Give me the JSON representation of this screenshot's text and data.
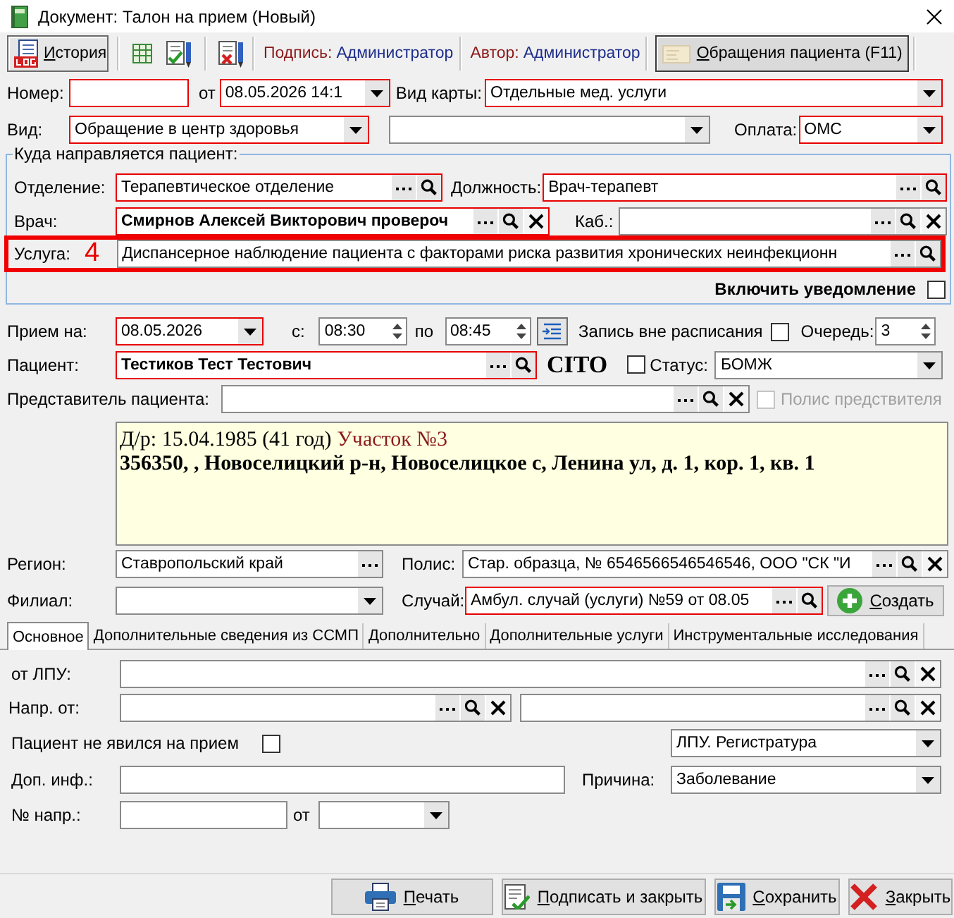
{
  "window": {
    "title": "Документ: Талон на прием (Новый)"
  },
  "toolbar": {
    "history_button": {
      "label": "История",
      "access_key_underlined": true
    },
    "signature": {
      "label": "Подпись:",
      "value": "Администратор"
    },
    "author": {
      "label": "Автор:",
      "value": "Администратор"
    },
    "patient_visits_button": {
      "label": "Обращения пациента (F11)",
      "pressed": true,
      "access_key_underlined": true
    }
  },
  "header": {
    "rows": [
      {
        "items": [
          {
            "kind": "label",
            "text": "Номер:"
          },
          {
            "kind": "text",
            "required": true
          },
          {
            "kind": "label",
            "text": "от"
          },
          {
            "kind": "combo",
            "value": "08.05.2026 14:1",
            "required": true
          },
          {
            "kind": "label",
            "text": "Вид карты:"
          },
          {
            "kind": "combo",
            "value": "Отдельные мед. услуги",
            "required": true
          }
        ]
      },
      {
        "items": [
          {
            "kind": "label",
            "text": "Вид:"
          },
          {
            "kind": "combo",
            "value": "Обращение в центр здоровья",
            "required": true
          },
          {
            "kind": "combo",
            "required": false
          },
          {
            "kind": "label",
            "text": "Оплата:"
          },
          {
            "kind": "combo",
            "value": "ОМС",
            "required": true
          }
        ]
      }
    ]
  },
  "referral": {
    "title": "Куда направляется пациент:",
    "rows": [
      {
        "highlighted": false,
        "items": [
          {
            "kind": "label",
            "text": "Отделение:"
          },
          {
            "kind": "lookup",
            "value": "Терапевтическое отделение",
            "required": true,
            "searchable": true,
            "clearable": false
          },
          {
            "kind": "label",
            "text": "Должность:"
          },
          {
            "kind": "lookup",
            "value": "Врач-терапевт",
            "required": true,
            "searchable": true,
            "clearable": false
          }
        ]
      },
      {
        "highlighted": false,
        "items": [
          {
            "kind": "label",
            "text": "Врач:"
          },
          {
            "kind": "lookup",
            "value": "Смирнов Алексей Викторович провероч",
            "required": true,
            "searchable": true,
            "clearable": true
          },
          {
            "kind": "label",
            "text": "Каб.:"
          },
          {
            "kind": "lookup",
            "required": false,
            "searchable": true,
            "clearable": true
          }
        ]
      },
      {
        "highlighted": true,
        "items": [
          {
            "kind": "label",
            "text": "Услуга:"
          },
          {
            "kind": "marker",
            "text": "4"
          },
          {
            "kind": "lookup",
            "value": "Диспансерное наблюдение пациента с факторами риска развития хронических неинфекционн",
            "required": false,
            "searchable": true,
            "clearable": false
          }
        ]
      },
      {
        "highlighted": false,
        "items": [
          {
            "kind": "label",
            "text": "Включить уведомление"
          },
          {
            "kind": "checkbox",
            "checked": false,
            "disabled": false
          }
        ]
      }
    ]
  },
  "appointment": {
    "rows": [
      {
        "items": [
          {
            "kind": "label",
            "text": "Прием на:"
          },
          {
            "kind": "combo",
            "value": "08.05.2026",
            "required": true
          },
          {
            "kind": "label",
            "text": "с:"
          },
          {
            "kind": "spin",
            "value": "08:30",
            "required": false
          },
          {
            "kind": "label",
            "text": "по"
          },
          {
            "kind": "spin",
            "value": "08:45",
            "required": false
          },
          {
            "kind": "tool"
          },
          {
            "kind": "label",
            "text": "Запись вне расписания"
          },
          {
            "kind": "checkbox",
            "checked": false,
            "disabled": false
          },
          {
            "kind": "label",
            "text": "Очередь:"
          },
          {
            "kind": "spin",
            "value": "3",
            "required": false
          }
        ]
      },
      {
        "items": [
          {
            "kind": "label",
            "text": "Пациент:"
          },
          {
            "kind": "lookup",
            "value": "Тестиков Тест Тестович",
            "required": true,
            "searchable": true,
            "clearable": false
          },
          {
            "kind": "tag",
            "text": "CITO"
          },
          {
            "kind": "checkbox",
            "checked": false,
            "disabled": false
          },
          {
            "kind": "label",
            "text": "Статус:"
          },
          {
            "kind": "combo",
            "value": "БОМЖ",
            "required": false
          }
        ]
      },
      {
        "items": [
          {
            "kind": "label",
            "text": "Представитель пациента:"
          },
          {
            "kind": "lookup",
            "required": false,
            "searchable": true,
            "clearable": true
          },
          {
            "kind": "checkbox",
            "label": "Полис предствителя",
            "checked": false,
            "disabled": true
          }
        ]
      },
      {
        "items": [
          {
            "kind": "info",
            "birth": "Д/р: 15.04.1985 (41 год)",
            "district": "Участок №3",
            "address": "356350, , Новоселицкий р-н, Новоселицкое с, Ленина ул, д. 1, кор. 1, кв. 1"
          }
        ]
      },
      {
        "items": [
          {
            "kind": "label",
            "text": "Регион:"
          },
          {
            "kind": "lookup",
            "value": "Ставропольский край",
            "required": false,
            "searchable": false,
            "clearable": false
          },
          {
            "kind": "label",
            "text": "Полис:"
          },
          {
            "kind": "lookup",
            "value": "Стар. образца, № 6546566546546546, ООО \"СК \"И",
            "required": false,
            "searchable": true,
            "clearable": true
          }
        ]
      },
      {
        "items": [
          {
            "kind": "label",
            "text": "Филиал:"
          },
          {
            "kind": "combo",
            "required": false
          },
          {
            "kind": "label",
            "text": "Случай:"
          },
          {
            "kind": "lookup",
            "value": "Амбул. случай (услуги) №59 от 08.05",
            "required": true,
            "searchable": true,
            "clearable": false
          },
          {
            "kind": "button",
            "label": "Создать",
            "access_key_underlined": true
          }
        ]
      }
    ]
  },
  "tabs": [
    {
      "label": "Основное",
      "selected": true
    },
    {
      "label": "Дополнительные сведения из ССМП",
      "selected": false
    },
    {
      "label": "Дополнительно",
      "selected": false
    },
    {
      "label": "Дополнительные услуги",
      "selected": false
    },
    {
      "label": "Инструментальные исследования",
      "selected": false
    }
  ],
  "tab_content": {
    "rows": [
      {
        "items": [
          {
            "kind": "label",
            "text": "от ЛПУ:"
          },
          {
            "kind": "lookup",
            "required": false,
            "searchable": true,
            "clearable": true
          }
        ]
      },
      {
        "items": [
          {
            "kind": "label",
            "text": "Напр. от:"
          },
          {
            "kind": "lookup",
            "required": false,
            "searchable": true,
            "clearable": true
          },
          {
            "kind": "lookup",
            "required": false,
            "searchable": true,
            "clearable": true
          }
        ]
      },
      {
        "items": [
          {
            "kind": "label",
            "text": "Пациент не явился на прием"
          },
          {
            "kind": "checkbox",
            "checked": false,
            "disabled": false
          },
          {
            "kind": "combo",
            "value": "ЛПУ. Регистратура",
            "required": false
          }
        ]
      },
      {
        "items": [
          {
            "kind": "label",
            "text": "Доп. инф.:"
          },
          {
            "kind": "text",
            "required": false
          },
          {
            "kind": "label",
            "text": "Причина:"
          },
          {
            "kind": "combo",
            "value": "Заболевание",
            "required": false
          }
        ]
      },
      {
        "items": [
          {
            "kind": "label",
            "text": "№ напр.:"
          },
          {
            "kind": "text",
            "required": false
          },
          {
            "kind": "label",
            "text": "от"
          },
          {
            "kind": "combo",
            "required": false
          }
        ]
      }
    ]
  },
  "footer_buttons": [
    {
      "kind": "print",
      "label": "Печать",
      "access_key_underlined": true
    },
    {
      "kind": "sign",
      "label": "Подписать и закрыть",
      "access_key_underlined": true
    },
    {
      "kind": "save",
      "label": "Сохранить",
      "access_key_underlined": true
    },
    {
      "kind": "close",
      "label": "Закрыть",
      "access_key_underlined": true
    }
  ]
}
